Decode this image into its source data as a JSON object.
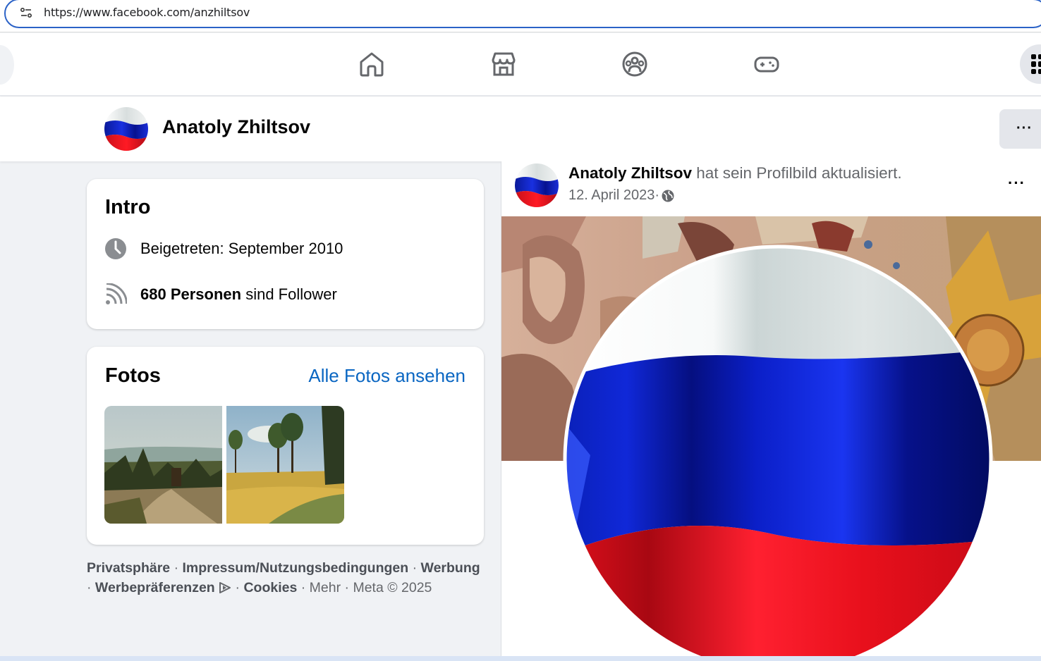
{
  "browser": {
    "url": "https://www.facebook.com/anzhiltsov"
  },
  "nav": {
    "icons": [
      "home-icon",
      "marketplace-icon",
      "groups-icon",
      "gaming-icon",
      "menu-grid-icon"
    ]
  },
  "profile": {
    "name": "Anatoly Zhiltsov",
    "more_label": "···"
  },
  "intro": {
    "title": "Intro",
    "joined": "Beigetreten: September 2010",
    "followers_count": "680 Personen",
    "followers_suffix": " sind Follower"
  },
  "photos": {
    "title": "Fotos",
    "see_all": "Alle Fotos ansehen"
  },
  "footer": {
    "privacy": "Privatsphäre",
    "sep": " · ",
    "imprint": "Impressum/Nutzungsbedingungen",
    "ads": "Werbung",
    "ad_prefs": "Werbepräferenzen",
    "cookies": "Cookies",
    "more": "Mehr",
    "meta": "Meta © 2025"
  },
  "post": {
    "author": "Anatoly Zhiltsov",
    "action": " hat sein Profilbild aktualisiert.",
    "date": "12. April 2023",
    "date_sep": " · ",
    "audience_icon": "globe-icon",
    "more_label": "···"
  },
  "colors": {
    "accent": "#0a66c2",
    "url_focus": "#2b62c7",
    "flag_white": "#f4f6f6",
    "flag_blue": "#0b22c8",
    "flag_red": "#e8101c"
  }
}
